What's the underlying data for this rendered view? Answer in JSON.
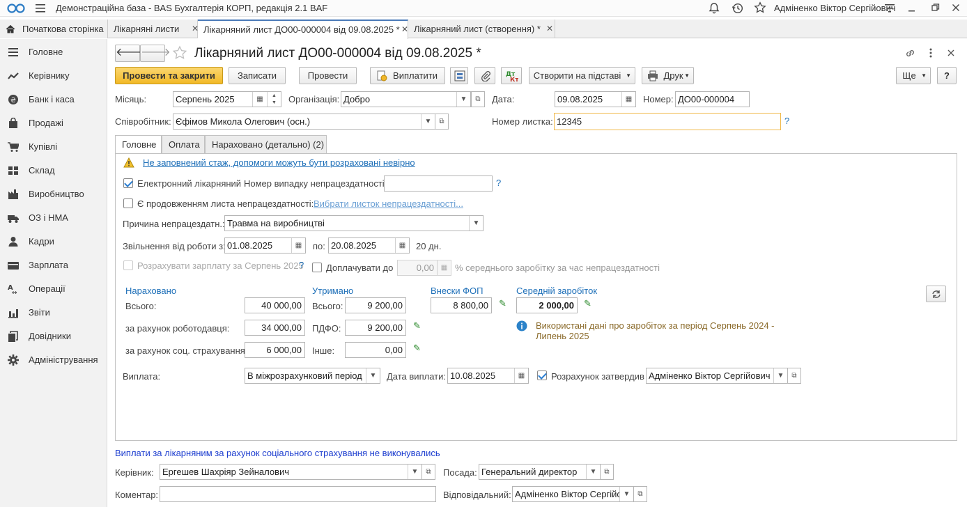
{
  "topbar": {
    "app_title": "Демонстраційна база - BAS Бухгалтерія КОРП, редакція 2.1 BAF",
    "user": "Адміненко Віктор Сергійович"
  },
  "tabs": [
    {
      "label": "Початкова сторінка"
    },
    {
      "label": "Лікарняні листи"
    },
    {
      "label": "Лікарняний лист ДО00-000004 від 09.08.2025 *"
    },
    {
      "label": "Лікарняний лист (створення) *"
    }
  ],
  "sidebar": {
    "items": [
      {
        "label": "Головне",
        "icon": "menu-icon"
      },
      {
        "label": "Керівнику",
        "icon": "trend-icon"
      },
      {
        "label": "Банк і каса",
        "icon": "coin-icon"
      },
      {
        "label": "Продажі",
        "icon": "bag-icon"
      },
      {
        "label": "Купівлі",
        "icon": "cart-icon"
      },
      {
        "label": "Склад",
        "icon": "warehouse-icon"
      },
      {
        "label": "Виробництво",
        "icon": "factory-icon"
      },
      {
        "label": "ОЗ і НМА",
        "icon": "truck-icon"
      },
      {
        "label": "Кадри",
        "icon": "person-icon"
      },
      {
        "label": "Зарплата",
        "icon": "wallet-icon"
      },
      {
        "label": "Операції",
        "icon": "operations-icon"
      },
      {
        "label": "Звіти",
        "icon": "bar-chart-icon"
      },
      {
        "label": "Довідники",
        "icon": "books-icon"
      },
      {
        "label": "Адміністрування",
        "icon": "gear-icon"
      }
    ]
  },
  "doc": {
    "title": "Лікарняний лист ДО00-000004 від 09.08.2025 *"
  },
  "toolbar": {
    "post_close": "Провести та закрити",
    "save": "Записати",
    "post": "Провести",
    "pay": "Виплатити",
    "create_based": "Створити на підставі",
    "print": "Друк",
    "more": "Ще",
    "help": "?"
  },
  "header": {
    "month_label": "Місяць:",
    "month_value": "Серпень 2025",
    "org_label": "Організація:",
    "org_value": "Добро",
    "date_label": "Дата:",
    "date_value": "09.08.2025",
    "number_label": "Номер:",
    "number_value": "ДО00-000004",
    "employee_label": "Співробітник:",
    "employee_value": "Єфімов Микола Олегович (осн.)",
    "sheet_number_label": "Номер листка:",
    "sheet_number_value": "12345",
    "question": "?"
  },
  "form_tabs": [
    {
      "label": "Головне"
    },
    {
      "label": "Оплата"
    },
    {
      "label": "Нараховано (детально) (2)"
    }
  ],
  "main": {
    "warning_text": "Не заповнений стаж, допомоги можуть бути розраховані невірно",
    "electronic_label": "Електронний лікарняний",
    "electronic_checked": true,
    "case_number_label": "Номер випадку непрацездатності:",
    "case_number_value": "",
    "continuation_label": "Є продовженням листа непрацездатності:",
    "continuation_checked": false,
    "choose_sheet_link": "Вибрати листок непрацездатності...",
    "reason_label": "Причина непрацездатн.:",
    "reason_value": "Травма на виробництві",
    "release_from_label": "Звільнення від роботи з:",
    "release_from_value": "01.08.2025",
    "release_to_label": "по:",
    "release_to_value": "20.08.2025",
    "days_text": "20 дн.",
    "calc_salary_label": "Розрахувати зарплату за Серпень 2025",
    "top_up_label": "Доплачувати до",
    "top_up_value": "0,00",
    "top_up_suffix": "% середнього заробітку за час непрацездатності",
    "accrued_header": "Нараховано",
    "withheld_header": "Утримано",
    "contrib_header": "Внески ФОП",
    "avg_header": "Середній заробіток",
    "total_label": "Всього:",
    "total_value": "40 000,00",
    "employer_label": "за рахунок роботодавця:",
    "employer_value": "34 000,00",
    "social_label": "за рахунок соц. страхування:",
    "social_value": "6 000,00",
    "withheld_total_label": "Всього:",
    "withheld_total_value": "9 200,00",
    "pdfo_label": "ПДФО:",
    "pdfo_value": "9 200,00",
    "other_label": "Інше:",
    "other_value": "0,00",
    "contrib_value": "8 800,00",
    "avg_value": "2 000,00",
    "info_text_1": "Використані дані про заробіток за період Серпень 2024 -",
    "info_text_2": "Липень 2025",
    "payment_label": "Виплата:",
    "payment_value": "В міжрозрахунковий період",
    "payment_date_label": "Дата виплати:",
    "payment_date_value": "10.08.2025",
    "approved_label": "Розрахунок затвердив",
    "approved_checked": true,
    "approved_value": "Адміненко Віктор Сергійович"
  },
  "footer": {
    "notice": "Виплати за лікарняним за рахунок соціального страхування не виконувались",
    "manager_label": "Керівник:",
    "manager_value": "Ергешев Шахріяр Зейналович",
    "position_label": "Посада:",
    "position_value": "Генеральний директор",
    "comment_label": "Коментар:",
    "comment_value": "",
    "responsible_label": "Відповідальний:",
    "responsible_value": "Адміненко Віктор Сергійс"
  },
  "colors": {
    "primary_button": "#f2b927",
    "link": "#1d6fb8",
    "sidebar_bg": "#f2f2f2"
  }
}
